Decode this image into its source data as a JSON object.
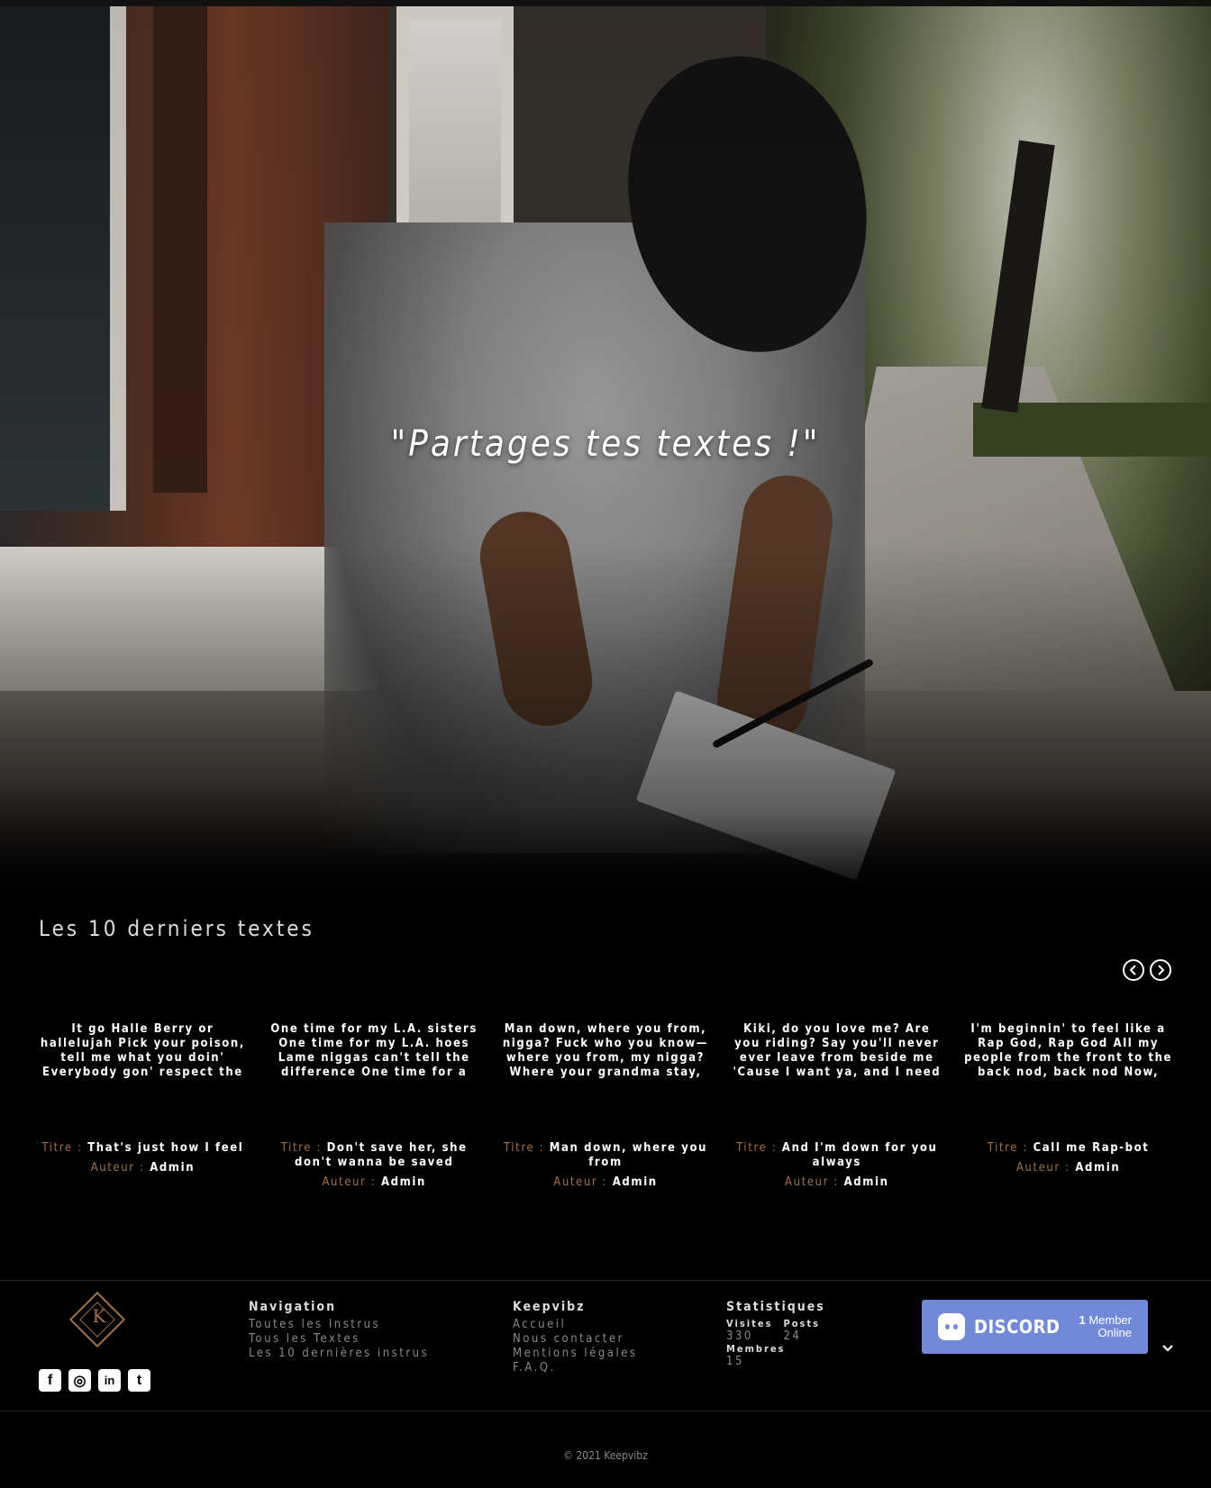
{
  "hero": {
    "tagline": "\"Partages tes textes !\""
  },
  "latest": {
    "title": "Les 10 derniers textes",
    "cards": [
      {
        "lyrics": "It go Halle Berry or hallelujah Pick your poison, tell me what you doin' Everybody gon' respect the shooter But the one in front of the gun…",
        "title_label": "Titre :",
        "title": "That's just how I feel",
        "author_label": "Auteur :",
        "author": "Admin"
      },
      {
        "lyrics": "One time for my L.A. sisters One time for my L.A. hoes Lame niggas can't tell the difference One time for a nigga who know Don't save…",
        "title_label": "Titre :",
        "title": "Don't save her, she don't wanna be saved",
        "author_label": "Auteur :",
        "author": "Admin"
      },
      {
        "lyrics": "Man down, where you from, nigga? Fuck who you know—where you from, my nigga? Where your grandma stay, huh, my nigga? This m.A.A.d…",
        "title_label": "Titre :",
        "title": "Man down, where you from",
        "author_label": "Auteur :",
        "author": "Admin"
      },
      {
        "lyrics": "Kiki, do you love me? Are you riding? Say you'll never ever leave from beside me 'Cause I want ya, and I need ya And I'm down for you always KB,…",
        "title_label": "Titre :",
        "title": "And I'm down for you always",
        "author_label": "Auteur :",
        "author": "Admin"
      },
      {
        "lyrics": "I'm beginnin' to feel like a Rap God, Rap God All my people from the front to the back nod, back nod Now, who thinks their arms are long…",
        "title_label": "Titre :",
        "title": "Call me Rap-bot",
        "author_label": "Auteur :",
        "author": "Admin"
      }
    ]
  },
  "footer": {
    "logo_letter": "K",
    "socials": [
      "f",
      "◎",
      "in",
      "t"
    ],
    "navigation": {
      "title": "Navigation",
      "links": [
        "Toutes les Instrus",
        "Tous les Textes",
        "Les 10 dernières instrus"
      ]
    },
    "keepvibz": {
      "title": "Keepvibz",
      "links": [
        "Accueil",
        "Nous contacter",
        "Mentions légales",
        "F.A.Q."
      ]
    },
    "stats": {
      "title": "Statistiques",
      "visits_label": "Visites",
      "visits": "330",
      "posts_label": "Posts",
      "posts": "24",
      "members_label": "Membres",
      "members": "15"
    },
    "discord": {
      "name": "DISCORD",
      "count": "1",
      "line1": "Member",
      "line2": "Online"
    },
    "copyright": "© 2021 Keepvibz"
  },
  "colors": {
    "accent": "#a0704a",
    "discord": "#7289da",
    "background": "#000000"
  }
}
